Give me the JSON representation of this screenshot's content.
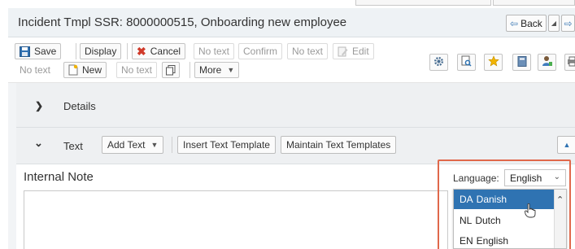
{
  "header": {
    "title": "Incident Tmpl SSR: 8000000515, Onboarding new employee",
    "back_label": "Back"
  },
  "toolbar": {
    "save": "Save",
    "display": "Display",
    "cancel": "Cancel",
    "no_text_1": "No text",
    "confirm": "Confirm",
    "no_text_2": "No text",
    "edit": "Edit",
    "no_text_3": "No text",
    "new": "New",
    "no_text_4": "No text",
    "more": "More"
  },
  "sections": {
    "details_label": "Details",
    "text_label": "Text",
    "add_text": "Add Text",
    "insert_template": "Insert Text Template",
    "maintain_templates": "Maintain Text Templates"
  },
  "note": {
    "title": "Internal Note",
    "language_label": "Language:",
    "language_value": "English"
  },
  "language_options": [
    {
      "code": "DA",
      "name": "Danish",
      "selected": true
    },
    {
      "code": "NL",
      "name": "Dutch",
      "selected": false
    },
    {
      "code": "EN",
      "name": "English",
      "selected": false
    }
  ],
  "colors": {
    "accent": "#2f73b2",
    "highlight_border": "#e0684b",
    "cancel_icon": "#d03a2a"
  }
}
